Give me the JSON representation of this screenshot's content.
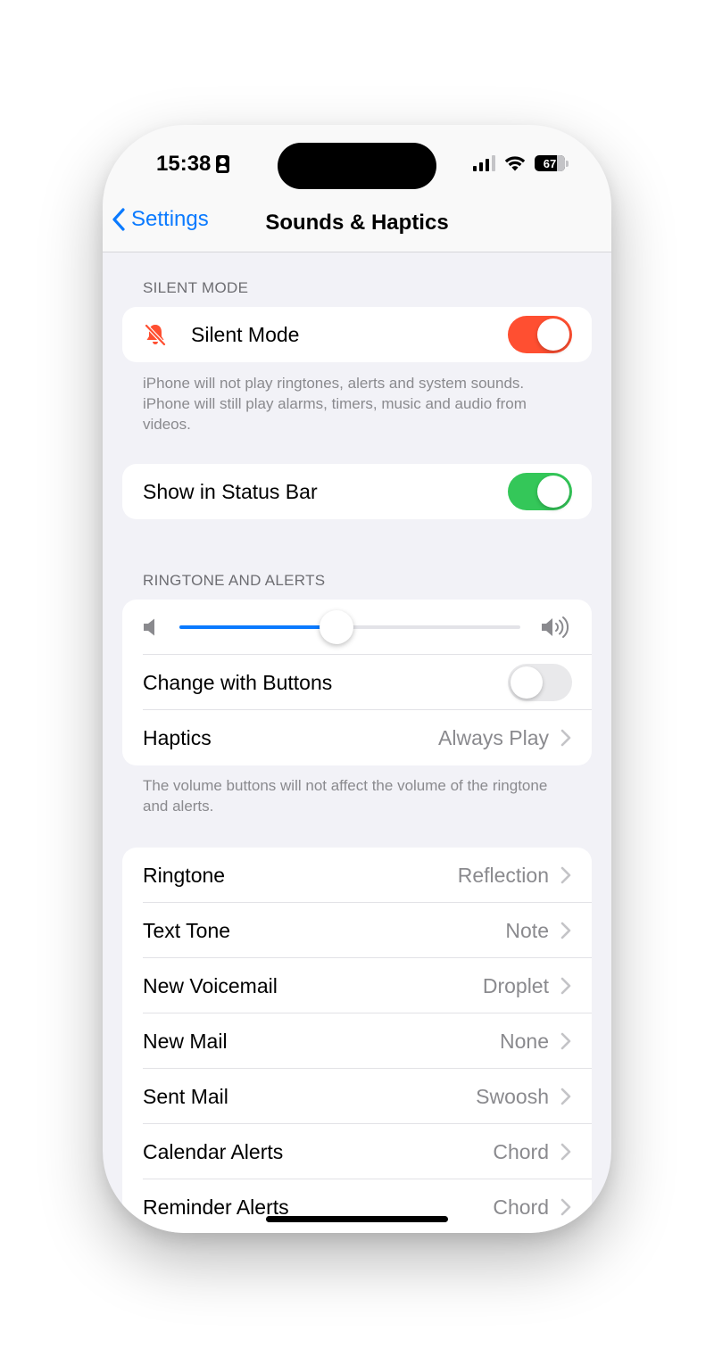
{
  "status_bar": {
    "time": "15:38",
    "battery": "67"
  },
  "nav": {
    "back_label": "Settings",
    "title": "Sounds & Haptics"
  },
  "silent_section": {
    "header": "SILENT MODE",
    "silent_mode_label": "Silent Mode",
    "silent_mode_on": true,
    "footer": "iPhone will not play ringtones, alerts and system sounds. iPhone will still play alarms, timers, music and audio from videos.",
    "status_bar_label": "Show in Status Bar",
    "status_bar_on": true
  },
  "ringtone_section": {
    "header": "RINGTONE AND ALERTS",
    "volume_level": 0.46,
    "change_with_buttons_label": "Change with Buttons",
    "change_with_buttons_on": false,
    "haptics_label": "Haptics",
    "haptics_value": "Always Play",
    "footer": "The volume buttons will not affect the volume of the ringtone and alerts."
  },
  "sounds_list": [
    {
      "label": "Ringtone",
      "value": "Reflection"
    },
    {
      "label": "Text Tone",
      "value": "Note"
    },
    {
      "label": "New Voicemail",
      "value": "Droplet"
    },
    {
      "label": "New Mail",
      "value": "None"
    },
    {
      "label": "Sent Mail",
      "value": "Swoosh"
    },
    {
      "label": "Calendar Alerts",
      "value": "Chord"
    },
    {
      "label": "Reminder Alerts",
      "value": "Chord"
    }
  ],
  "colors": {
    "accent": "#0a7aff",
    "silent_toggle": "#ff4f31",
    "status_toggle": "#34c759",
    "toggle_off": "#e9e9eb",
    "silent_icon": "#ff4f31"
  }
}
